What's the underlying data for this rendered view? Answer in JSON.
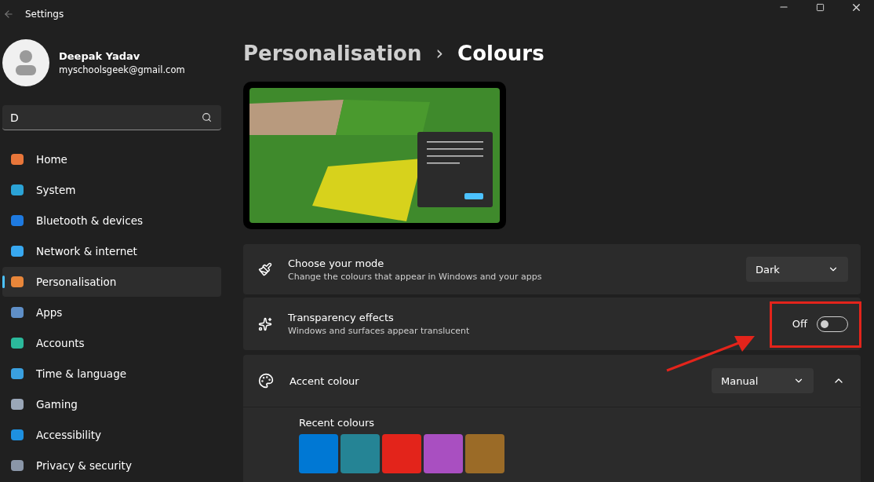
{
  "window": {
    "title": "Settings"
  },
  "profile": {
    "name": "Deepak Yadav",
    "email": "myschoolsgeek@gmail.com"
  },
  "search": {
    "value": "D"
  },
  "sidebar": {
    "items": [
      {
        "label": "Home",
        "selected": false
      },
      {
        "label": "System",
        "selected": false
      },
      {
        "label": "Bluetooth & devices",
        "selected": false
      },
      {
        "label": "Network & internet",
        "selected": false
      },
      {
        "label": "Personalisation",
        "selected": true
      },
      {
        "label": "Apps",
        "selected": false
      },
      {
        "label": "Accounts",
        "selected": false
      },
      {
        "label": "Time & language",
        "selected": false
      },
      {
        "label": "Gaming",
        "selected": false
      },
      {
        "label": "Accessibility",
        "selected": false
      },
      {
        "label": "Privacy & security",
        "selected": false
      }
    ]
  },
  "breadcrumb": {
    "parent": "Personalisation",
    "separator": "›",
    "current": "Colours"
  },
  "settings": [
    {
      "kind": "dropdown",
      "title": "Choose your mode",
      "description": "Change the colours that appear in Windows and your apps",
      "value": "Dark"
    },
    {
      "kind": "toggle",
      "title": "Transparency effects",
      "description": "Windows and surfaces appear translucent",
      "state_label": "Off",
      "on": false
    },
    {
      "kind": "expander",
      "title": "Accent colour",
      "value": "Manual",
      "expanded": true
    }
  ],
  "recent_colours": {
    "label": "Recent colours",
    "swatches": [
      {
        "color": "#0078d4"
      },
      {
        "color": "#258495"
      },
      {
        "color": "#e3241b"
      },
      {
        "color": "#a94fc1"
      },
      {
        "color": "#9b6b27"
      }
    ]
  }
}
